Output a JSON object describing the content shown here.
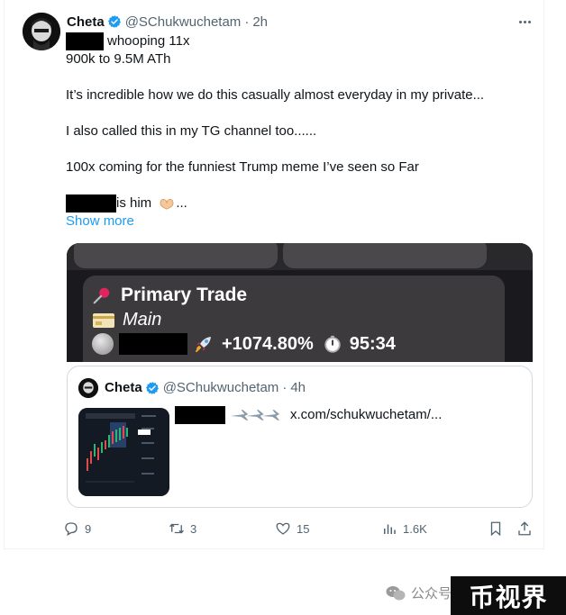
{
  "tweet": {
    "author_name": "Cheta",
    "handle": "@SChukwuchetam",
    "separator": "·",
    "time": "2h",
    "lines": [
      "whooping 11x",
      "900k to 9.5M ATh",
      "It’s incredible how we do this casually almost everyday in my private...",
      "I also called this in my TG channel too......",
      "100x coming for the funniest Trump meme I’ve seen so Far",
      "is him"
    ],
    "last_line_suffix": "...",
    "show_more": "Show more"
  },
  "media_card": {
    "title": "Primary Trade",
    "subtitle": "Main",
    "gain": "+1074.80%",
    "timer": "95:34"
  },
  "quoted_tweet": {
    "author_name": "Cheta",
    "handle": "@SChukwuchetam",
    "separator": "·",
    "time": "4h",
    "link": "x.com/schukwuchetam/..."
  },
  "actions": {
    "replies": "9",
    "retweets": "3",
    "likes": "15",
    "views": "1.6K"
  },
  "watermark": {
    "text": "公众号",
    "brand": "币视界"
  },
  "colors": {
    "accent": "#1d9bf0",
    "secondary_text": "#536471",
    "media_bg": "#1a1a1e"
  },
  "icons": [
    "verified-badge-icon",
    "more-icon",
    "pin-icon",
    "card-icon",
    "coin-icon",
    "rocket-icon",
    "stopwatch-icon",
    "airplane-icon",
    "reply-icon",
    "retweet-icon",
    "like-icon",
    "views-icon",
    "bookmark-icon",
    "share-icon",
    "wechat-icon"
  ]
}
